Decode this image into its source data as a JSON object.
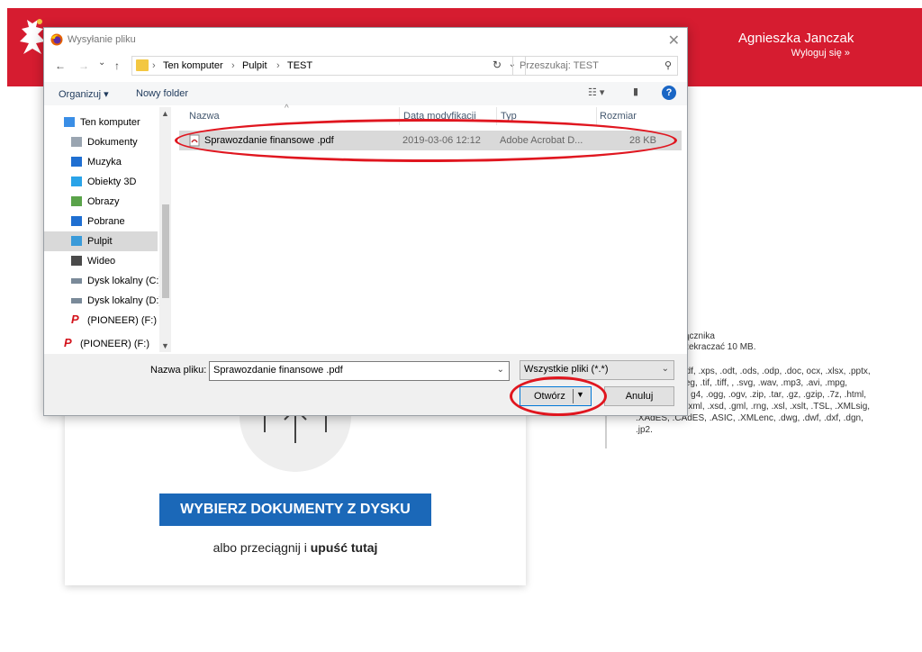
{
  "page": {
    "user_name": "Agnieszka Janczak",
    "logout": "Wyloguj się »",
    "upload": {
      "button": "WYBIERZ DOKUMENTY Z DYSKU",
      "drop_prefix": "albo przeciągnij i ",
      "drop_bold": "upuść tutaj"
    },
    "attachment_info": {
      "title": "ącznika",
      "max_size": "zekraczać 10 MB.",
      "formats": "e: .txt, .rtf, .pdf, .xps, .odt, .ods, .odp, .doc, ocx, .xlsx, .pptx, .csv, .jpg, .jpeg, .tif, .tiff, , .svg, .wav, .mp3, .avi, .mpg, .mpeg, .mp4, g4, .ogg, .ogv, .zip, .tar, .gz, .gzip, .7z, .html, .xhtml, .css, .xml, .xsd, .gml, .rng, .xsl, .xslt, .TSL, .XMLsig, .XAdES, .CAdES, .ASIC, .XMLenc, .dwg, .dwf, .dxf, .dgn, .jp2."
    }
  },
  "dialog": {
    "title": "Wysyłanie pliku",
    "close": "✕",
    "nav": {
      "back": "←",
      "forward": "→",
      "recent": "⌄",
      "up": "↑"
    },
    "breadcrumb": [
      "Ten komputer",
      "Pulpit",
      "TEST"
    ],
    "breadcrumb_sep": "›",
    "search_placeholder": "Przeszukaj: TEST",
    "toolbar": {
      "organize": "Organizuj ▾",
      "new_folder": "Nowy folder",
      "help": "?"
    },
    "sidebar": [
      {
        "label": "Ten komputer",
        "icon": "computer-icon",
        "color": "#3a8ee6"
      },
      {
        "label": "Dokumenty",
        "icon": "documents-icon",
        "color": "#9aa5b1"
      },
      {
        "label": "Muzyka",
        "icon": "music-icon",
        "color": "#1f6fd1"
      },
      {
        "label": "Obiekty 3D",
        "icon": "objects-3d-icon",
        "color": "#2aa3e8"
      },
      {
        "label": "Obrazy",
        "icon": "pictures-icon",
        "color": "#5aa34a"
      },
      {
        "label": "Pobrane",
        "icon": "download-icon",
        "color": "#1f6fd1"
      },
      {
        "label": "Pulpit",
        "icon": "desktop-icon",
        "color": "#3a9ad9"
      },
      {
        "label": "Wideo",
        "icon": "video-icon",
        "color": "#4a4a4a"
      },
      {
        "label": "Dysk lokalny (C:)",
        "icon": "drive-icon",
        "color": "#7a8a99"
      },
      {
        "label": "Dysk lokalny (D:)",
        "icon": "drive-icon",
        "color": "#7a8a99"
      },
      {
        "label": "(PIONEER) (F:)",
        "icon": "pioneer-icon",
        "color": "#d3131b"
      },
      {
        "label": "(PIONEER) (F:)",
        "icon": "pioneer-icon",
        "color": "#d3131b"
      }
    ],
    "columns": [
      "Nazwa",
      "Data modyfikacji",
      "Typ",
      "Rozmiar"
    ],
    "files": [
      {
        "name": "Sprawozdanie finansowe .pdf",
        "modified": "2019-03-06 12:12",
        "type": "Adobe Acrobat D...",
        "size": "28 KB"
      }
    ],
    "filename_label": "Nazwa pliku:",
    "filename_value": "Sprawozdanie finansowe .pdf",
    "filter": "Wszystkie pliki (*.*)",
    "open": "Otwórz",
    "cancel": "Anuluj"
  },
  "colors": {
    "brand_red": "#d61c30",
    "button_blue": "#1b68b8",
    "annotation_red": "#e0161f"
  }
}
